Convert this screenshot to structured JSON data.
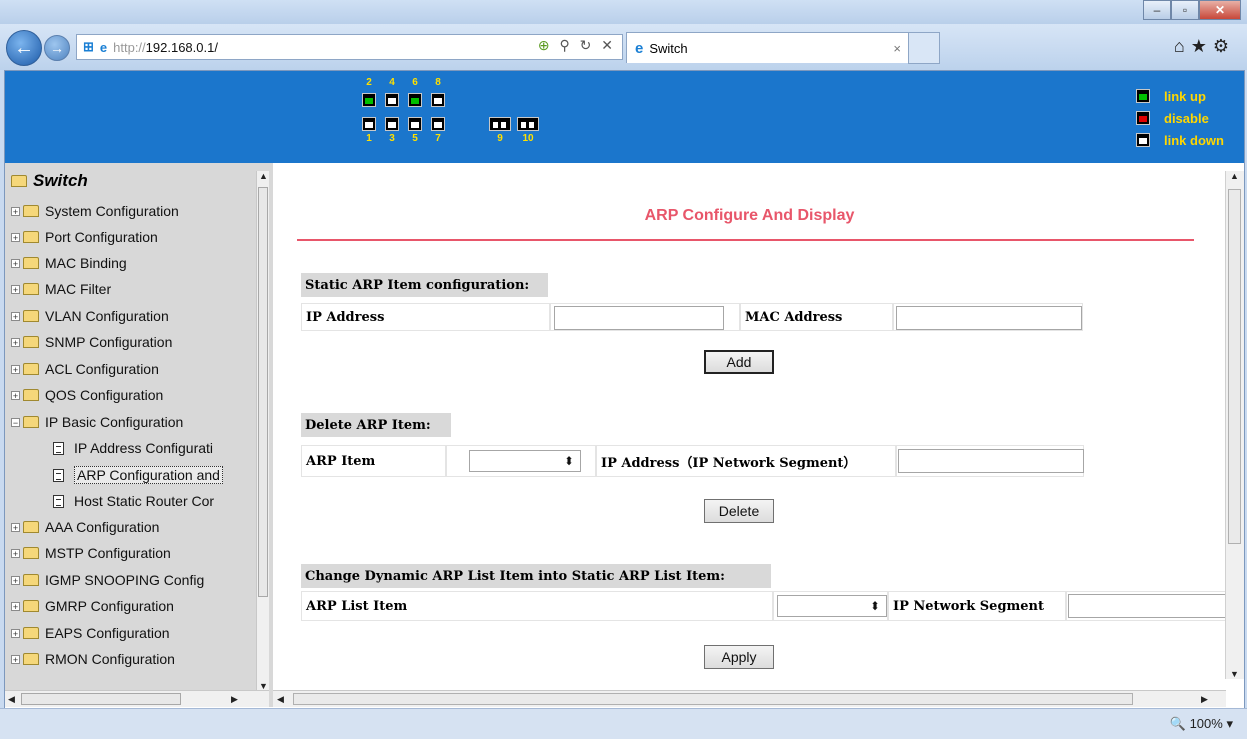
{
  "browser": {
    "address_prefix": "http://",
    "address_host": "192.168.0.1/",
    "tab_title": "Switch",
    "tab_close": "×",
    "zoom": "🔍 100%",
    "zoom_caret": "▾"
  },
  "banner": {
    "top_numbers": [
      "2",
      "4",
      "6",
      "8"
    ],
    "bottom_numbers": [
      "1",
      "3",
      "5",
      "7",
      "9",
      "10"
    ],
    "legend": [
      {
        "label": "link up",
        "color": "#00c000"
      },
      {
        "label": "disable",
        "color": "#e00000"
      },
      {
        "label": "link down",
        "color": "#ffffff"
      }
    ]
  },
  "tree": {
    "root": "Switch",
    "items": [
      {
        "label": "System Configuration"
      },
      {
        "label": "Port Configuration"
      },
      {
        "label": "MAC Binding"
      },
      {
        "label": "MAC Filter"
      },
      {
        "label": "VLAN Configuration"
      },
      {
        "label": "SNMP Configuration"
      },
      {
        "label": "ACL Configuration"
      },
      {
        "label": "QOS Configuration"
      },
      {
        "label": "IP Basic Configuration"
      }
    ],
    "subitems": [
      {
        "label": "IP Address Configurati"
      },
      {
        "label": "ARP Configuration and"
      },
      {
        "label": "Host Static Router Cor"
      }
    ],
    "items2": [
      {
        "label": "AAA Configuration"
      },
      {
        "label": "MSTP Configuration"
      },
      {
        "label": "IGMP SNOOPING Config"
      },
      {
        "label": "GMRP Configuration"
      },
      {
        "label": "EAPS Configuration"
      },
      {
        "label": "RMON Configuration"
      }
    ]
  },
  "main": {
    "title": "ARP Configure And Display",
    "static": {
      "heading": "Static ARP Item configuration:",
      "ip_label": "IP Address",
      "mac_label": "MAC Address",
      "ip_value": "",
      "mac_value": "",
      "add_button": "Add"
    },
    "delete": {
      "heading": "Delete ARP Item:",
      "arp_label": "ARP Item",
      "arp_value": "",
      "ip_label": "IP Address（IP Network Segment）",
      "ip_value": "",
      "delete_button": "Delete"
    },
    "change": {
      "heading": "Change Dynamic ARP List Item into Static ARP List Item:",
      "list_label": "ARP List Item",
      "list_value": "",
      "seg_label": "IP Network Segment",
      "seg_value": "",
      "apply_button": "Apply"
    }
  }
}
